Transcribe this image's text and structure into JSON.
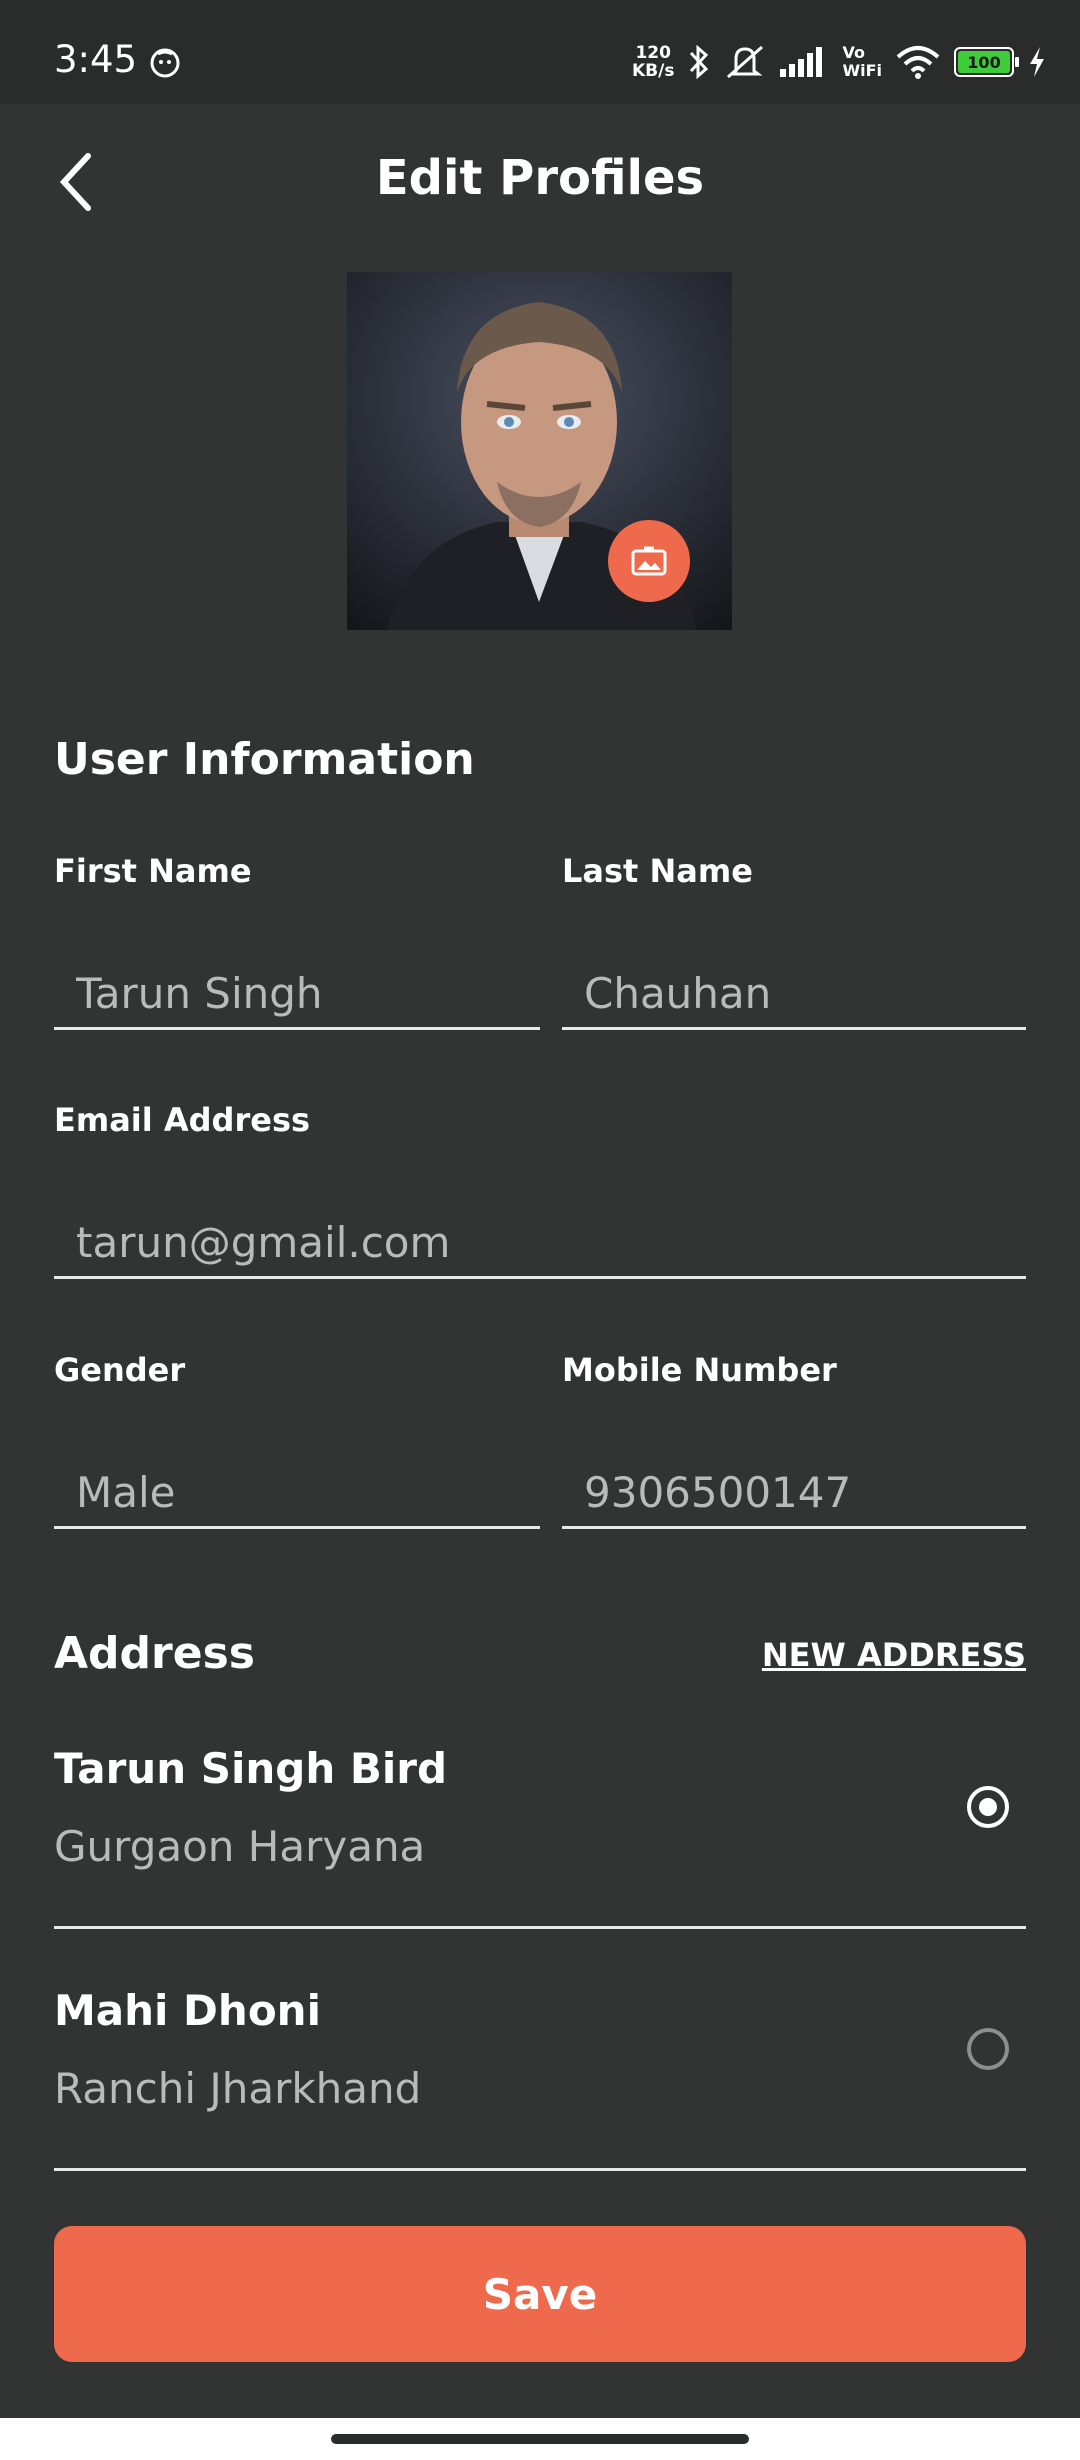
{
  "status_bar": {
    "time": "3:45",
    "network_speed": "120\nKB/s",
    "vowifi": "Vo\nWiFi",
    "battery": "100"
  },
  "header": {
    "title": "Edit Profiles"
  },
  "user_information": {
    "section_title": "User Information",
    "first_name_label": "First Name",
    "first_name_value": "Tarun Singh",
    "last_name_label": "Last Name",
    "last_name_value": "Chauhan",
    "email_label": "Email Address",
    "email_value": "tarun@gmail.com",
    "gender_label": "Gender",
    "gender_value": "Male",
    "mobile_label": "Mobile Number",
    "mobile_value": "9306500147"
  },
  "address": {
    "section_title": "Address",
    "new_address_label": "NEW ADDRESS",
    "items": [
      {
        "name": "Tarun Singh Bird",
        "location": "Gurgaon Haryana",
        "selected": true
      },
      {
        "name": "Mahi Dhoni",
        "location": "Ranchi Jharkhand",
        "selected": false
      }
    ]
  },
  "actions": {
    "save_label": "Save"
  },
  "colors": {
    "background": "#323433",
    "accent": "#ef6a4d"
  }
}
